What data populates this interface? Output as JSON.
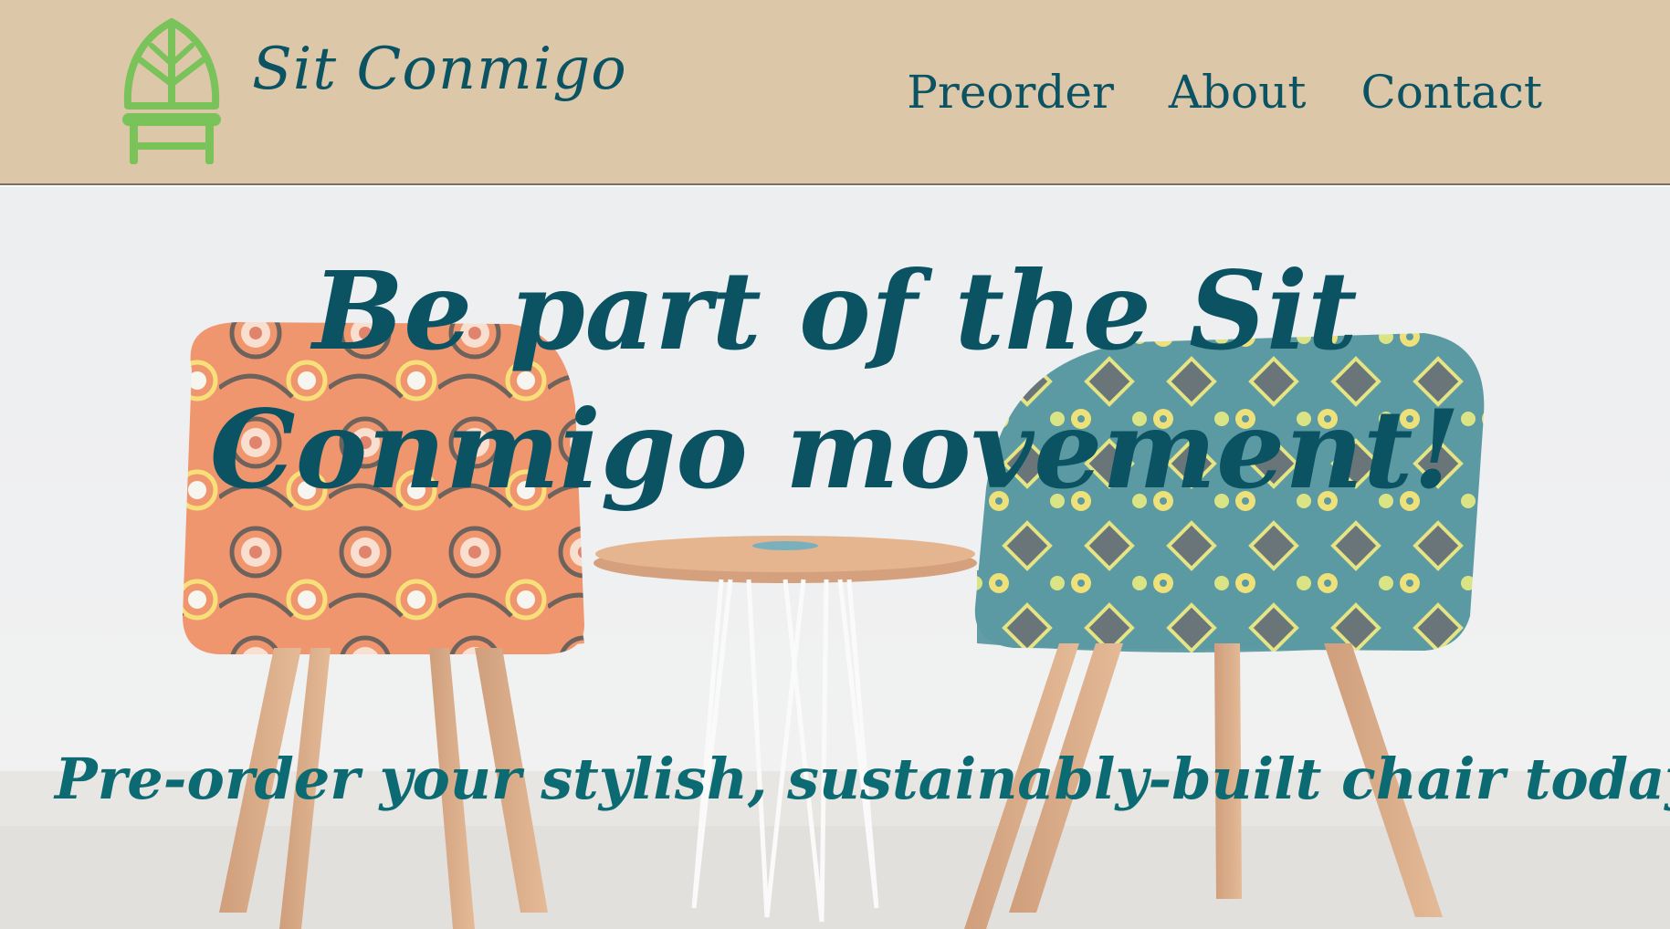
{
  "header": {
    "brand": "Sit Conmigo",
    "logo_icon": "leaf-chair-icon",
    "nav": [
      "Preorder",
      "About",
      "Contact"
    ]
  },
  "hero": {
    "headline": "Be part of the Sit Conmigo movement!",
    "subline": "Pre-order your stylish, sustainably-built chair today!",
    "image": "two patterned armchairs with a small round side table"
  },
  "colors": {
    "header_bg": "#dcc8a8",
    "text": "#0b5363",
    "logo": "#7ac25a"
  }
}
